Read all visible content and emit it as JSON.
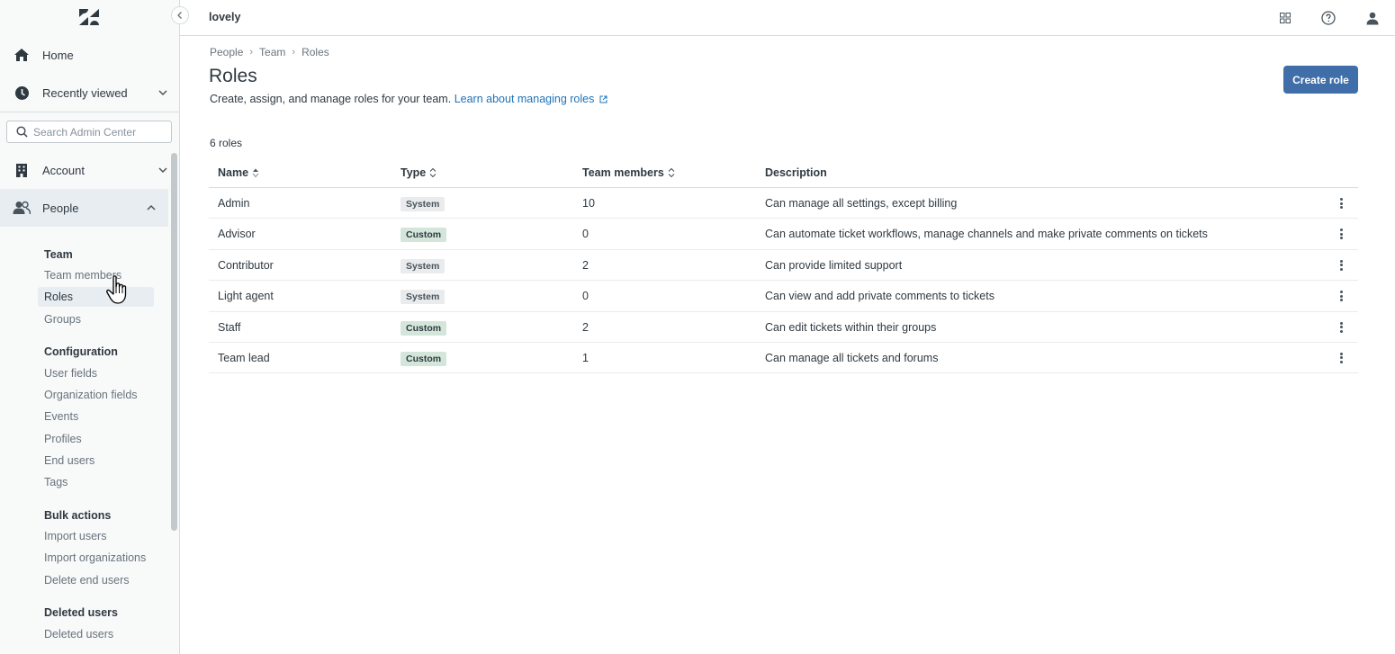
{
  "app": {
    "brand": "lovely"
  },
  "sidebar": {
    "top": [
      {
        "label": "Home",
        "icon": "home-icon"
      },
      {
        "label": "Recently viewed",
        "icon": "clock-icon"
      }
    ],
    "search_placeholder": "Search Admin Center",
    "sections": [
      {
        "label": "Account",
        "icon": "building-icon"
      },
      {
        "label": "People",
        "icon": "people-icon"
      }
    ],
    "subnav": {
      "team_heading": "Team",
      "team_items": [
        "Team members",
        "Roles",
        "Groups"
      ],
      "config_heading": "Configuration",
      "config_items": [
        "User fields",
        "Organization fields",
        "Events",
        "Profiles",
        "End users",
        "Tags"
      ],
      "bulk_heading": "Bulk actions",
      "bulk_items": [
        "Import users",
        "Import organizations",
        "Delete end users"
      ],
      "deleted_heading": "Deleted users",
      "deleted_items": [
        "Deleted users"
      ]
    }
  },
  "breadcrumb": [
    "People",
    "Team",
    "Roles"
  ],
  "page": {
    "title": "Roles",
    "description": "Create, assign, and manage roles for your team.",
    "learn_link": "Learn about managing roles",
    "create_button": "Create role",
    "count": "6 roles"
  },
  "table": {
    "headers": [
      "Name",
      "Type",
      "Team members",
      "Description"
    ],
    "rows": [
      {
        "name": "Admin",
        "type": "System",
        "members": "10",
        "description": "Can manage all settings, except billing"
      },
      {
        "name": "Advisor",
        "type": "Custom",
        "members": "0",
        "description": "Can automate ticket workflows, manage channels and make private comments on tickets"
      },
      {
        "name": "Contributor",
        "type": "System",
        "members": "2",
        "description": "Can provide limited support"
      },
      {
        "name": "Light agent",
        "type": "System",
        "members": "0",
        "description": "Can view and add private comments to tickets"
      },
      {
        "name": "Staff",
        "type": "Custom",
        "members": "2",
        "description": "Can edit tickets within their groups"
      },
      {
        "name": "Team lead",
        "type": "Custom",
        "members": "1",
        "description": "Can manage all tickets and forums"
      }
    ]
  },
  "colors": {
    "primary": "#3f6ea9",
    "link": "#1f73b7",
    "custom_badge": "#d4e6da",
    "system_badge": "#e9ebed"
  }
}
